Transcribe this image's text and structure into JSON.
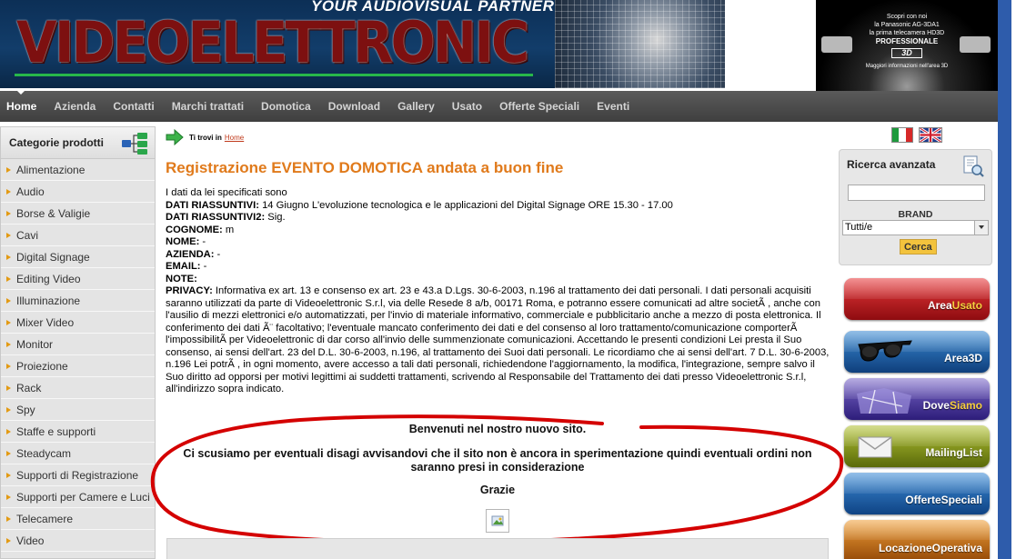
{
  "header": {
    "tagline": "YOUR AUDIOVISUAL PARTNER",
    "logo_text": "VIDEOELETTRONIC",
    "promo": {
      "line1": "Scopri con noi",
      "line2": "la Panasonic AG-3DA1",
      "line3": "la prima telecamera HD3D",
      "line4": "PROFESSIONALE",
      "badge": "3D",
      "footer": "Maggiori informazioni nell'area 3D"
    }
  },
  "nav": {
    "items": [
      "Home",
      "Azienda",
      "Contatti",
      "Marchi trattati",
      "Domotica",
      "Download",
      "Gallery",
      "Usato",
      "Offerte Speciali",
      "Eventi"
    ],
    "active": "Home"
  },
  "sidebar": {
    "title": "Categorie prodotti",
    "items": [
      "Alimentazione",
      "Audio",
      "Borse & Valigie",
      "Cavi",
      "Digital Signage",
      "Editing Video",
      "Illuminazione",
      "Mixer Video",
      "Monitor",
      "Proiezione",
      "Rack",
      "Spy",
      "Staffe e supporti",
      "Steadycam",
      "Supporti di Registrazione",
      "Supporti per Camere e Luci",
      "Telecamere",
      "Video"
    ]
  },
  "breadcrumb": {
    "label": "Ti trovi in",
    "link": "Home"
  },
  "main": {
    "title": "Registrazione EVENTO DOMOTICA andata a buon fine",
    "intro": "I dati da lei specificati sono",
    "fields": [
      {
        "label": "DATI RIASSUNTIVI:",
        "value": " 14 Giugno L'evoluzione tecnologica e le applicazioni del Digital Signage ORE 15.30 - 17.00"
      },
      {
        "label": "DATI RIASSUNTIVI2:",
        "value": " Sig."
      },
      {
        "label": "COGNOME:",
        "value": " m"
      },
      {
        "label": "NOME:",
        "value": " -"
      },
      {
        "label": "AZIENDA:",
        "value": " -"
      },
      {
        "label": "EMAIL:",
        "value": " -"
      },
      {
        "label": "NOTE:",
        "value": ""
      }
    ],
    "privacy_label": "PRIVACY:",
    "privacy_text": " Informativa ex art. 13 e consenso ex art. 23 e 43.a D.Lgs. 30-6-2003, n.196 al trattamento dei dati personali. I dati personali acquisiti saranno utilizzati da parte di Videoelettronic S.r.l, via delle Resede 8 a/b, 00171 Roma, e potranno essere comunicati ad altre societÃ  , anche con l'ausilio di mezzi elettronici e/o automatizzati, per l'invio di materiale informativo, commerciale e pubblicitario anche a mezzo di posta elettronica. Il conferimento dei dati Ã¨ facoltativo; l'eventuale mancato conferimento dei dati e del consenso al loro trattamento/comunicazione comporterÃ  l'impossibilitÃ  per Videoelettronic di dar corso all'invio delle summenzionate comunicazioni. Accettando le presenti condizioni Lei presta il Suo consenso, ai sensi dell'art. 23 del D.L. 30-6-2003, n.196, al trattamento dei Suoi dati personali. Le ricordiamo che ai sensi dell'art. 7 D.L. 30-6-2003, n.196 Lei potrÃ  , in ogni momento, avere accesso a tali dati personali, richiedendone l'aggiornamento, la modifica, l'integrazione, sempre salvo il Suo diritto ad opporsi per motivi legittimi ai suddetti trattamenti, scrivendo al Responsabile del Trattamento dei dati presso Videoelettronic S.r.l, all'indirizzo sopra indicato."
  },
  "notice": {
    "welcome": "Benvenuti nel nostro nuovo sito.",
    "message": "Ci scusiamo per eventuali disagi avvisandovi che il sito non è ancora in sperimentazione quindi eventuali ordini non saranno presi in considerazione",
    "thanks": "Grazie"
  },
  "search": {
    "title": "Ricerca avanzata",
    "input_value": "",
    "brand_label": "BRAND",
    "brand_selected": "Tutti/e",
    "button": "Cerca"
  },
  "areas": [
    {
      "part1": "Area",
      "part2": "Usato",
      "color_top": "#e8383a",
      "color_bottom": "#8e0c10",
      "accent": "#f6cf3f"
    },
    {
      "part1": "Area",
      "part2": "3D",
      "color_top": "#3a8ad3",
      "color_bottom": "#0f3f7c",
      "accent": "#ffffff"
    },
    {
      "part1": "Dove",
      "part2": "Siamo",
      "color_top": "#7b68c9",
      "color_bottom": "#2d1d7a",
      "accent": "#f6cf3f"
    },
    {
      "part1": "Mailing",
      "part2": "List",
      "color_top": "#b2c234",
      "color_bottom": "#5a6a0a",
      "accent": "#ffffff"
    },
    {
      "part1": "Offerte",
      "part2": "Speciali",
      "color_top": "#3c8bd6",
      "color_bottom": "#0f4384",
      "accent": "#ffffff"
    },
    {
      "part1": "Locazione",
      "part2": "Operativa",
      "color_top": "#f0a03a",
      "color_bottom": "#9a4e0a",
      "accent": "#ffffff"
    }
  ],
  "colors": {
    "title_orange": "#e07a1b",
    "nav_bg": "#4a4a4a",
    "sidebar_bg": "#e4e4e4",
    "bullet": "#e39a12",
    "annotation_red": "#d40000",
    "blue_stripe": "#2e5cab"
  },
  "icons": {
    "category_tree": "tree-icon",
    "search_docs": "search-docs-icon",
    "breadcrumb_arrow": "green-arrow-icon",
    "placeholder_image": "image-icon"
  }
}
